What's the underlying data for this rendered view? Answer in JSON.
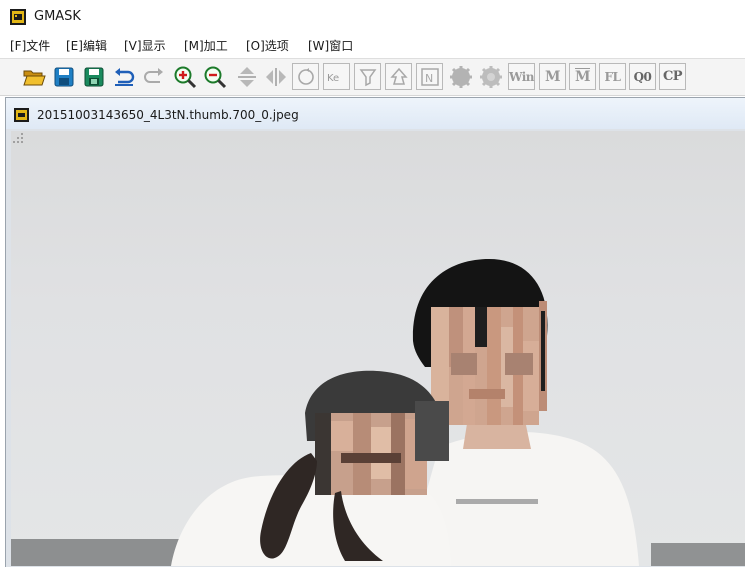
{
  "app": {
    "title": "GMASK",
    "icon": "gmask-app-icon"
  },
  "menu": {
    "items": [
      {
        "label": "[F]文件"
      },
      {
        "label": "[E]编辑"
      },
      {
        "label": "[V]显示"
      },
      {
        "label": "[M]加工"
      },
      {
        "label": "[O]选项"
      },
      {
        "label": "[W]窗口"
      }
    ]
  },
  "toolbar": {
    "buttons": [
      {
        "icon": "open-folder-icon"
      },
      {
        "icon": "save-icon"
      },
      {
        "icon": "save-as-icon"
      },
      {
        "icon": "undo-icon"
      },
      {
        "icon": "redo-icon"
      },
      {
        "icon": "zoom-in-icon"
      },
      {
        "icon": "zoom-out-icon"
      },
      {
        "icon": "flip-vertical-icon"
      },
      {
        "icon": "flip-horizontal-icon"
      },
      {
        "icon": "rotate-icon"
      },
      {
        "icon": "key-icon"
      },
      {
        "icon": "filter-down-icon"
      },
      {
        "icon": "filter-up-icon"
      },
      {
        "icon": "negative-icon"
      },
      {
        "icon": "gear-filled-icon"
      },
      {
        "icon": "gear-outline-icon"
      },
      {
        "icon": "win-icon",
        "label": "Win"
      },
      {
        "icon": "m-icon",
        "label": "M"
      },
      {
        "icon": "m-bar-icon",
        "label": "M"
      },
      {
        "icon": "fl-icon",
        "label": "FL"
      },
      {
        "icon": "q0-icon",
        "label": "Q0"
      },
      {
        "icon": "cp-icon",
        "label": "CP"
      }
    ]
  },
  "document": {
    "title": "20151003143650_4L3tN.thumb.700_0.jpeg",
    "icon": "image-doc-icon"
  },
  "colors": {
    "accent": "#e2b616",
    "toolbar_active": "#1f7fc4",
    "doc_titlebar": "#e5edf7"
  }
}
